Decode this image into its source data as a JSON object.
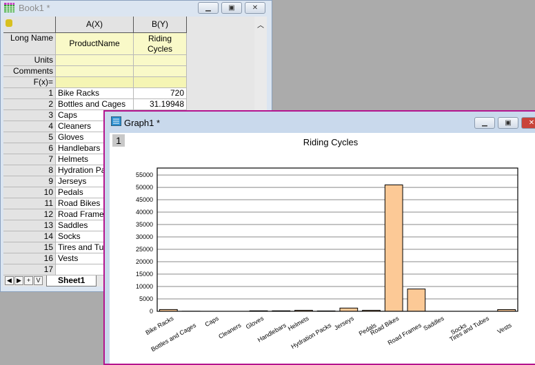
{
  "book": {
    "title": "Book1 *",
    "columns": [
      {
        "header": "A(X)",
        "long_name": "ProductName"
      },
      {
        "header": "B(Y)",
        "long_name": "Riding Cycles"
      }
    ],
    "meta_labels": [
      "Long Name",
      "Units",
      "Comments",
      "F(x)="
    ],
    "rows": [
      [
        "1",
        "Bike Racks",
        "720"
      ],
      [
        "2",
        "Bottles and Cages",
        "31.19948"
      ],
      [
        "3",
        "Caps",
        ""
      ],
      [
        "4",
        "Cleaners",
        ""
      ],
      [
        "5",
        "Gloves",
        ""
      ],
      [
        "6",
        "Handlebars",
        ""
      ],
      [
        "7",
        "Helmets",
        ""
      ],
      [
        "8",
        "Hydration Packs",
        ""
      ],
      [
        "9",
        "Jerseys",
        ""
      ],
      [
        "10",
        "Pedals",
        ""
      ],
      [
        "11",
        "Road Bikes",
        ""
      ],
      [
        "12",
        "Road Frames",
        ""
      ],
      [
        "13",
        "Saddles",
        ""
      ],
      [
        "14",
        "Socks",
        ""
      ],
      [
        "15",
        "Tires and Tubes",
        ""
      ],
      [
        "16",
        "Vests",
        ""
      ],
      [
        "17",
        "",
        ""
      ]
    ],
    "sheet_tab": "Sheet1",
    "tab_buttons": [
      "◀",
      "▶",
      "+",
      "V"
    ]
  },
  "graph": {
    "title": "Graph1 *",
    "layer": "1"
  },
  "chart_data": {
    "type": "bar",
    "title": "Riding Cycles",
    "xlabel": "",
    "ylabel": "",
    "categories": [
      "Bike Racks",
      "Bottles and Cages",
      "Caps",
      "Cleaners",
      "Gloves",
      "Handlebars",
      "Helmets",
      "Hydration Packs",
      "Jerseys",
      "Pedals",
      "Road Bikes",
      "Road Frames",
      "Saddles",
      "Socks",
      "Tires and Tubes",
      "Vests"
    ],
    "values": [
      720,
      31.19948,
      0,
      0,
      200,
      200,
      400,
      150,
      1300,
      400,
      51000,
      9000,
      0,
      0,
      0,
      700
    ],
    "yticks": [
      0,
      5000,
      10000,
      15000,
      20000,
      25000,
      30000,
      35000,
      40000,
      45000,
      50000,
      55000
    ],
    "ylim": [
      0,
      57800
    ],
    "grid": true,
    "bar_color": "#fcc996"
  }
}
